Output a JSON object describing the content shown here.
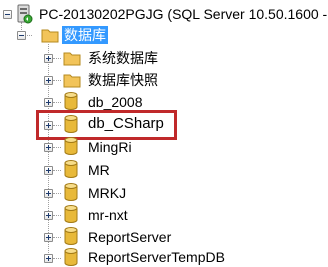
{
  "server": {
    "label": "PC-20130202PGJG (SQL Server 10.50.1600 -",
    "icon": "server-icon"
  },
  "databases_folder": {
    "label": "数据库",
    "selected": true,
    "icon": "folder-icon"
  },
  "items": [
    {
      "label": "系统数据库",
      "icon": "folder-icon"
    },
    {
      "label": "数据库快照",
      "icon": "folder-icon"
    },
    {
      "label": "db_2008",
      "icon": "database-icon"
    },
    {
      "label": "db_CSharp",
      "icon": "database-icon",
      "highlighted": true
    },
    {
      "label": "MingRi",
      "icon": "database-icon"
    },
    {
      "label": "MR",
      "icon": "database-icon"
    },
    {
      "label": "MRKJ",
      "icon": "database-icon"
    },
    {
      "label": "mr-nxt",
      "icon": "database-icon"
    },
    {
      "label": "ReportServer",
      "icon": "database-icon"
    },
    {
      "label": "ReportServerTempDB",
      "icon": "database-icon"
    }
  ],
  "colors": {
    "selection": "#3399ff",
    "highlight_box": "#c0292a",
    "folder": "#f2c45a",
    "database": "#e8b93a"
  }
}
